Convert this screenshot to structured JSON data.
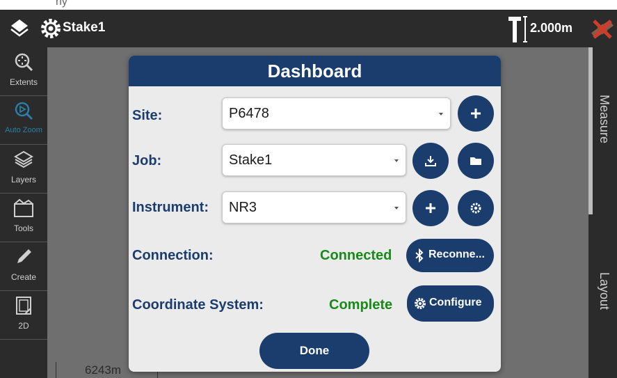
{
  "app": {
    "job_title": "Stake1",
    "pole_height": "2.000m",
    "top_strip_text": "ny"
  },
  "sidebar": {
    "items": [
      {
        "label": "Extents",
        "icon": "extents-icon"
      },
      {
        "label": "Auto Zoom",
        "icon": "auto-zoom-icon"
      },
      {
        "label": "Layers",
        "icon": "layers-icon"
      },
      {
        "label": "Tools",
        "icon": "tools-icon"
      },
      {
        "label": "Create",
        "icon": "pencil-icon"
      },
      {
        "label": "2D",
        "icon": "2d-view-icon"
      }
    ]
  },
  "right_tabs": {
    "measure": "Measure",
    "layout": "Layout"
  },
  "map": {
    "scale_label": "6243m"
  },
  "dashboard": {
    "title": "Dashboard",
    "site_label": "Site:",
    "site_value": "P6478",
    "job_label": "Job:",
    "job_value": "Stake1",
    "instrument_label": "Instrument:",
    "instrument_value": "NR3",
    "connection_label": "Connection:",
    "connection_status": "Connected",
    "reconnect_label": "Reconne...",
    "coord_label": "Coordinate System:",
    "coord_status": "Complete",
    "configure_label": "Configure",
    "done_label": "Done"
  },
  "colors": {
    "primary": "#1b3d6e",
    "status_green": "#188a18",
    "toolbar": "#2b2b2b",
    "active": "#2a7fa8"
  }
}
